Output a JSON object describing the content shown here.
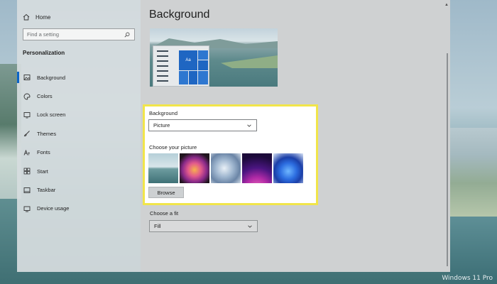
{
  "watermark": "Windows 11 Pro",
  "sidebar": {
    "home_label": "Home",
    "search_placeholder": "Find a setting",
    "section_title": "Personalization",
    "items": [
      {
        "label": "Background",
        "icon": "image-icon",
        "active": true
      },
      {
        "label": "Colors",
        "icon": "palette-icon"
      },
      {
        "label": "Lock screen",
        "icon": "lock-screen-icon"
      },
      {
        "label": "Themes",
        "icon": "brush-icon"
      },
      {
        "label": "Fonts",
        "icon": "font-icon"
      },
      {
        "label": "Start",
        "icon": "start-icon"
      },
      {
        "label": "Taskbar",
        "icon": "taskbar-icon"
      },
      {
        "label": "Device usage",
        "icon": "device-usage-icon"
      }
    ]
  },
  "main": {
    "title": "Background",
    "preview_tile_text": "Aa",
    "background_label": "Background",
    "background_value": "Picture",
    "choose_picture_label": "Choose your picture",
    "browse_label": "Browse",
    "fit_label": "Choose a fit",
    "fit_value": "Fill"
  },
  "colors": {
    "accent": "#0a64c8",
    "highlight_border": "#f1e54a"
  }
}
